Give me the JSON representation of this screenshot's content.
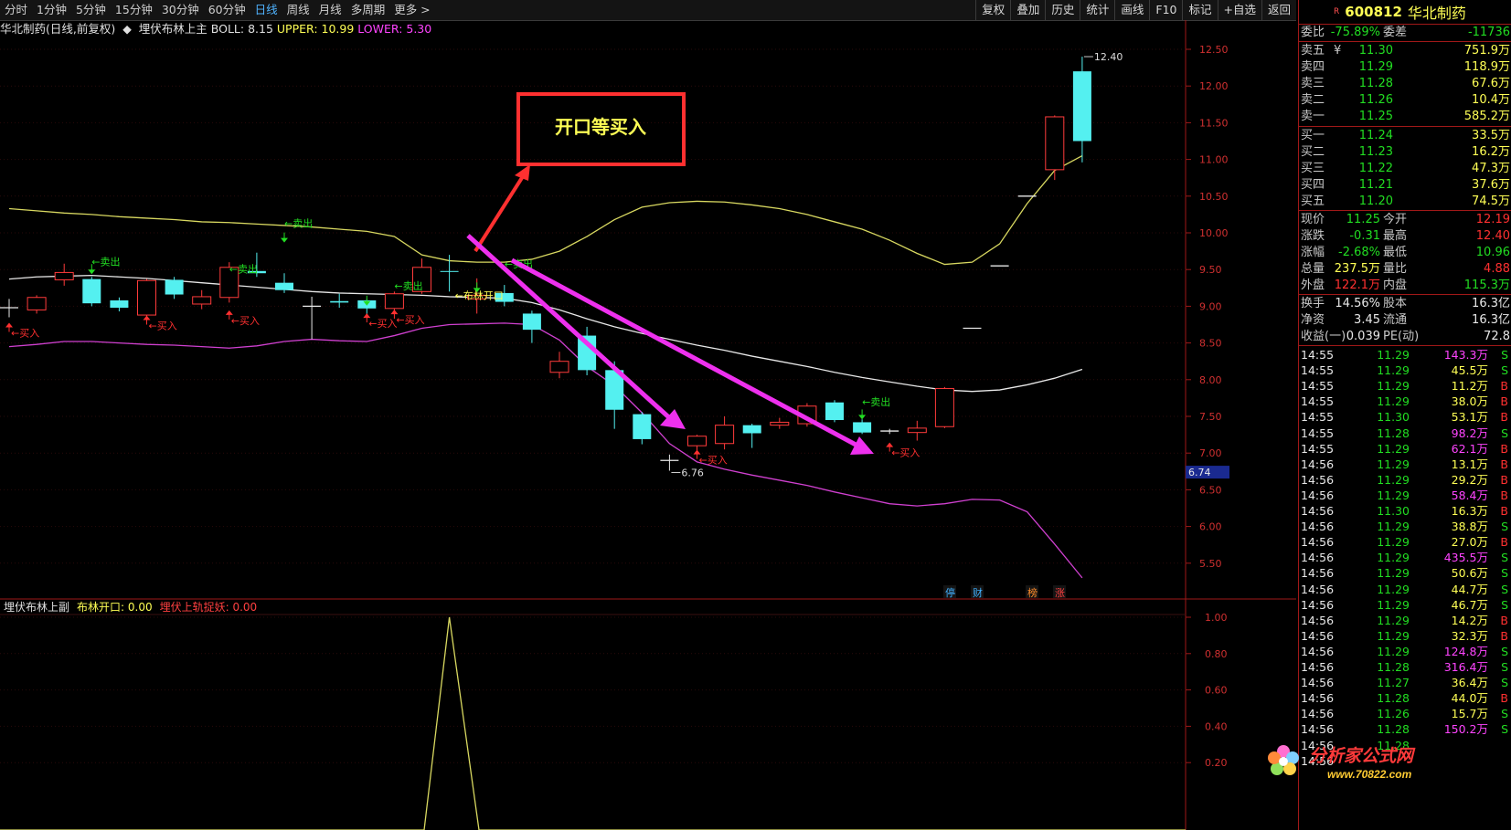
{
  "toolbar": {
    "periods": [
      "分时",
      "1分钟",
      "5分钟",
      "15分钟",
      "30分钟",
      "60分钟",
      "日线",
      "周线",
      "月线",
      "多周期",
      "更多 >"
    ],
    "active_period": "日线",
    "buttons": [
      "复权",
      "叠加",
      "历史",
      "统计",
      "画线",
      "F10",
      "标记",
      "+自选",
      "返回"
    ]
  },
  "main_chart": {
    "stock_label": "华北制药(日线,前复权)",
    "indicator_name": "埋伏布林上主",
    "boll": "BOLL: 8.15",
    "upper": "UPPER: 10.99",
    "lower": "LOWER: 5.30",
    "y_ticks": [
      "12.50",
      "12.00",
      "11.50",
      "11.00",
      "10.50",
      "10.00",
      "9.50",
      "9.00",
      "8.50",
      "8.00",
      "7.50",
      "7.00",
      "6.50",
      "6.00",
      "5.50"
    ],
    "current_price_tag": "6.74",
    "high_label": "12.40",
    "low_label": "6.76",
    "callout_text": "开口等买入",
    "signal_labels": {
      "buy": "←买入",
      "sell": "←卖出",
      "boll_open": "←布林开口"
    },
    "bottom_badges": [
      "停",
      "财",
      "榜",
      "涨"
    ]
  },
  "sub_chart": {
    "indicator_name": "埋伏布林上副",
    "line1": "布林开口: 0.00",
    "line2": "埋伏上轨捉妖: 0.00",
    "y_ticks": [
      "1.00",
      "0.80",
      "0.60",
      "0.40",
      "0.20"
    ]
  },
  "chart_data": {
    "type": "candlestick",
    "title": "华北制药(日线,前复权)",
    "ylim": [
      5.3,
      12.7
    ],
    "candles": [
      {
        "o": 8.98,
        "c": 8.98,
        "h": 9.1,
        "l": 8.85
      },
      {
        "o": 8.95,
        "c": 9.12,
        "h": 9.15,
        "l": 8.9
      },
      {
        "o": 9.36,
        "c": 9.46,
        "h": 9.58,
        "l": 9.28
      },
      {
        "o": 9.37,
        "c": 9.04,
        "h": 9.4,
        "l": 9.0
      },
      {
        "o": 9.08,
        "c": 8.98,
        "h": 9.12,
        "l": 8.93
      },
      {
        "o": 8.88,
        "c": 9.35,
        "h": 9.37,
        "l": 8.8
      },
      {
        "o": 9.36,
        "c": 9.16,
        "h": 9.4,
        "l": 9.1
      },
      {
        "o": 9.03,
        "c": 9.13,
        "h": 9.22,
        "l": 8.96
      },
      {
        "o": 9.12,
        "c": 9.53,
        "h": 9.6,
        "l": 9.05
      },
      {
        "o": 9.48,
        "c": 9.45,
        "h": 9.73,
        "l": 9.4
      },
      {
        "o": 9.32,
        "c": 9.22,
        "h": 9.45,
        "l": 9.18
      },
      {
        "o": 9.0,
        "c": 9.0,
        "h": 9.13,
        "l": 8.55
      },
      {
        "o": 9.07,
        "c": 9.05,
        "h": 9.17,
        "l": 8.98
      },
      {
        "o": 9.08,
        "c": 8.97,
        "h": 9.1,
        "l": 8.88
      },
      {
        "o": 8.97,
        "c": 9.17,
        "h": 9.2,
        "l": 8.9
      },
      {
        "o": 9.2,
        "c": 9.53,
        "h": 9.65,
        "l": 9.17
      },
      {
        "o": 9.48,
        "c": 9.47,
        "h": 9.7,
        "l": 9.2
      },
      {
        "o": 9.1,
        "c": 9.15,
        "h": 9.38,
        "l": 8.9
      },
      {
        "o": 9.18,
        "c": 9.06,
        "h": 9.29,
        "l": 9.0
      },
      {
        "o": 8.9,
        "c": 8.68,
        "h": 8.94,
        "l": 8.5
      },
      {
        "o": 8.1,
        "c": 8.25,
        "h": 8.38,
        "l": 8.02
      },
      {
        "o": 8.6,
        "c": 8.13,
        "h": 8.72,
        "l": 8.06
      },
      {
        "o": 8.13,
        "c": 7.59,
        "h": 8.25,
        "l": 7.33
      },
      {
        "o": 7.53,
        "c": 7.19,
        "h": 7.56,
        "l": 7.12
      },
      {
        "o": 6.9,
        "c": 6.9,
        "h": 6.98,
        "l": 6.76
      },
      {
        "o": 7.1,
        "c": 7.23,
        "h": 7.25,
        "l": 6.98
      },
      {
        "o": 7.13,
        "c": 7.38,
        "h": 7.5,
        "l": 7.05
      },
      {
        "o": 7.38,
        "c": 7.27,
        "h": 7.4,
        "l": 7.07
      },
      {
        "o": 7.38,
        "c": 7.42,
        "h": 7.48,
        "l": 7.33
      },
      {
        "o": 7.4,
        "c": 7.64,
        "h": 7.68,
        "l": 7.36
      },
      {
        "o": 7.69,
        "c": 7.45,
        "h": 7.72,
        "l": 7.42
      },
      {
        "o": 7.42,
        "c": 7.28,
        "h": 7.46,
        "l": 7.26
      },
      {
        "o": 7.3,
        "c": 7.3,
        "h": 7.33,
        "l": 7.26
      },
      {
        "o": 7.28,
        "c": 7.34,
        "h": 7.44,
        "l": 7.17
      },
      {
        "o": 7.36,
        "c": 7.88,
        "h": 7.9,
        "l": 7.34
      },
      {
        "o": 8.7,
        "c": 8.7,
        "h": 8.7,
        "l": 8.7
      },
      {
        "o": 9.55,
        "c": 9.55,
        "h": 9.55,
        "l": 9.55
      },
      {
        "o": 10.5,
        "c": 10.5,
        "h": 10.5,
        "l": 10.5
      },
      {
        "o": 10.86,
        "c": 11.58,
        "h": 11.6,
        "l": 10.72
      },
      {
        "o": 12.2,
        "c": 11.25,
        "h": 12.4,
        "l": 10.96
      }
    ],
    "upper": [
      10.33,
      10.3,
      10.27,
      10.25,
      10.22,
      10.2,
      10.18,
      10.15,
      10.14,
      10.12,
      10.1,
      10.08,
      10.05,
      10.02,
      9.95,
      9.7,
      9.62,
      9.6,
      9.6,
      9.64,
      9.75,
      9.95,
      10.18,
      10.35,
      10.41,
      10.43,
      10.42,
      10.38,
      10.33,
      10.25,
      10.15,
      10.05,
      9.9,
      9.72,
      9.57,
      9.6,
      9.85,
      10.4,
      10.85,
      11.05
    ],
    "mid": [
      9.37,
      9.4,
      9.41,
      9.42,
      9.4,
      9.38,
      9.35,
      9.32,
      9.29,
      9.26,
      9.23,
      9.2,
      9.18,
      9.17,
      9.16,
      9.15,
      9.13,
      9.12,
      9.11,
      9.05,
      8.95,
      8.83,
      8.72,
      8.63,
      8.55,
      8.47,
      8.4,
      8.32,
      8.25,
      8.18,
      8.1,
      8.03,
      7.97,
      7.91,
      7.86,
      7.84,
      7.86,
      7.93,
      8.02,
      8.14
    ],
    "lower": [
      8.45,
      8.48,
      8.52,
      8.52,
      8.5,
      8.48,
      8.47,
      8.45,
      8.43,
      8.46,
      8.52,
      8.55,
      8.53,
      8.52,
      8.6,
      8.7,
      8.75,
      8.76,
      8.77,
      8.75,
      8.54,
      8.18,
      7.92,
      7.55,
      7.13,
      6.88,
      6.78,
      6.7,
      6.63,
      6.56,
      6.47,
      6.39,
      6.31,
      6.28,
      6.31,
      6.37,
      6.36,
      6.2,
      5.76,
      5.3
    ],
    "current_price": 6.74
  },
  "quote_panel": {
    "code": "600812",
    "name": "华北制药",
    "r_badge": "R",
    "weibi": {
      "label": "委比",
      "value": "-75.89%",
      "label2": "委差",
      "value2": "-11736"
    },
    "asks": [
      {
        "label": "卖五",
        "price": "11.30",
        "vol": "751.9万",
        "mark": "¥"
      },
      {
        "label": "卖四",
        "price": "11.29",
        "vol": "118.9万",
        "mark": ""
      },
      {
        "label": "卖三",
        "price": "11.28",
        "vol": "67.6万",
        "mark": ""
      },
      {
        "label": "卖二",
        "price": "11.26",
        "vol": "10.4万",
        "mark": ""
      },
      {
        "label": "卖一",
        "price": "11.25",
        "vol": "585.2万",
        "mark": ""
      }
    ],
    "bids": [
      {
        "label": "买一",
        "price": "11.24",
        "vol": "33.5万"
      },
      {
        "label": "买二",
        "price": "11.23",
        "vol": "16.2万"
      },
      {
        "label": "买三",
        "price": "11.22",
        "vol": "47.3万"
      },
      {
        "label": "买四",
        "price": "11.21",
        "vol": "37.6万"
      },
      {
        "label": "买五",
        "price": "11.20",
        "vol": "74.5万"
      }
    ],
    "stats": [
      {
        "l1": "现价",
        "v1": "11.25",
        "c1": "green",
        "l2": "今开",
        "v2": "12.19",
        "c2": "red"
      },
      {
        "l1": "涨跌",
        "v1": "-0.31",
        "c1": "green",
        "l2": "最高",
        "v2": "12.40",
        "c2": "red"
      },
      {
        "l1": "涨幅",
        "v1": "-2.68%",
        "c1": "green",
        "l2": "最低",
        "v2": "10.96",
        "c2": "green"
      },
      {
        "l1": "总量",
        "v1": "237.5万",
        "c1": "yellow",
        "l2": "量比",
        "v2": "4.88",
        "c2": "red"
      },
      {
        "l1": "外盘",
        "v1": "122.1万",
        "c1": "red",
        "l2": "内盘",
        "v2": "115.3万",
        "c2": "green"
      }
    ],
    "stats2": [
      {
        "l1": "换手",
        "v1": "14.56%",
        "l2": "股本",
        "v2": "16.3亿"
      },
      {
        "l1": "净资",
        "v1": "3.45",
        "l2": "流通",
        "v2": "16.3亿"
      },
      {
        "l1": "收益(一)",
        "v1": "0.039",
        "l2": "PE(动)",
        "v2": "72.8"
      }
    ],
    "ticks": [
      {
        "t": "14:55",
        "p": "11.29",
        "v": "143.3万",
        "s": "S",
        "vc": "mag"
      },
      {
        "t": "14:55",
        "p": "11.29",
        "v": "45.5万",
        "s": "S",
        "vc": "yellow"
      },
      {
        "t": "14:55",
        "p": "11.29",
        "v": "11.2万",
        "s": "B",
        "vc": "yellow"
      },
      {
        "t": "14:55",
        "p": "11.29",
        "v": "38.0万",
        "s": "B",
        "vc": "yellow"
      },
      {
        "t": "14:55",
        "p": "11.30",
        "v": "53.1万",
        "s": "B",
        "vc": "yellow"
      },
      {
        "t": "14:55",
        "p": "11.28",
        "v": "98.2万",
        "s": "S",
        "vc": "mag"
      },
      {
        "t": "14:55",
        "p": "11.29",
        "v": "62.1万",
        "s": "B",
        "vc": "mag"
      },
      {
        "t": "14:56",
        "p": "11.29",
        "v": "13.1万",
        "s": "B",
        "vc": "yellow"
      },
      {
        "t": "14:56",
        "p": "11.29",
        "v": "29.2万",
        "s": "B",
        "vc": "yellow"
      },
      {
        "t": "14:56",
        "p": "11.29",
        "v": "58.4万",
        "s": "B",
        "vc": "mag"
      },
      {
        "t": "14:56",
        "p": "11.30",
        "v": "16.3万",
        "s": "B",
        "vc": "yellow"
      },
      {
        "t": "14:56",
        "p": "11.29",
        "v": "38.8万",
        "s": "S",
        "vc": "yellow"
      },
      {
        "t": "14:56",
        "p": "11.29",
        "v": "27.0万",
        "s": "B",
        "vc": "yellow"
      },
      {
        "t": "14:56",
        "p": "11.29",
        "v": "435.5万",
        "s": "S",
        "vc": "mag"
      },
      {
        "t": "14:56",
        "p": "11.29",
        "v": "50.6万",
        "s": "S",
        "vc": "yellow"
      },
      {
        "t": "14:56",
        "p": "11.29",
        "v": "44.7万",
        "s": "S",
        "vc": "yellow"
      },
      {
        "t": "14:56",
        "p": "11.29",
        "v": "46.7万",
        "s": "S",
        "vc": "yellow"
      },
      {
        "t": "14:56",
        "p": "11.29",
        "v": "14.2万",
        "s": "B",
        "vc": "yellow"
      },
      {
        "t": "14:56",
        "p": "11.29",
        "v": "32.3万",
        "s": "B",
        "vc": "yellow"
      },
      {
        "t": "14:56",
        "p": "11.29",
        "v": "124.8万",
        "s": "S",
        "vc": "mag"
      },
      {
        "t": "14:56",
        "p": "11.28",
        "v": "316.4万",
        "s": "S",
        "vc": "mag"
      },
      {
        "t": "14:56",
        "p": "11.27",
        "v": "36.4万",
        "s": "S",
        "vc": "yellow"
      },
      {
        "t": "14:56",
        "p": "11.28",
        "v": "44.0万",
        "s": "B",
        "vc": "yellow"
      },
      {
        "t": "14:56",
        "p": "11.26",
        "v": "15.7万",
        "s": "S",
        "vc": "yellow"
      },
      {
        "t": "14:56",
        "p": "11.28",
        "v": "150.2万",
        "s": "S",
        "vc": "mag"
      },
      {
        "t": "14:56",
        "p": "11.28",
        "v": "",
        "s": "",
        "vc": "yellow"
      },
      {
        "t": "14:56",
        "p": "",
        "v": "",
        "s": "",
        "vc": "yellow"
      }
    ]
  },
  "watermark": {
    "text": "分析家公式网",
    "url": "www.70822.com"
  },
  "colors": {
    "up": "#ff3b3b",
    "down": "#54f0f0",
    "upper_band": "#d8d860",
    "mid_band": "#e8e8e8",
    "lower_band": "#d040d0",
    "annotation": "#ff3030",
    "arrow": "#ee30ee"
  }
}
